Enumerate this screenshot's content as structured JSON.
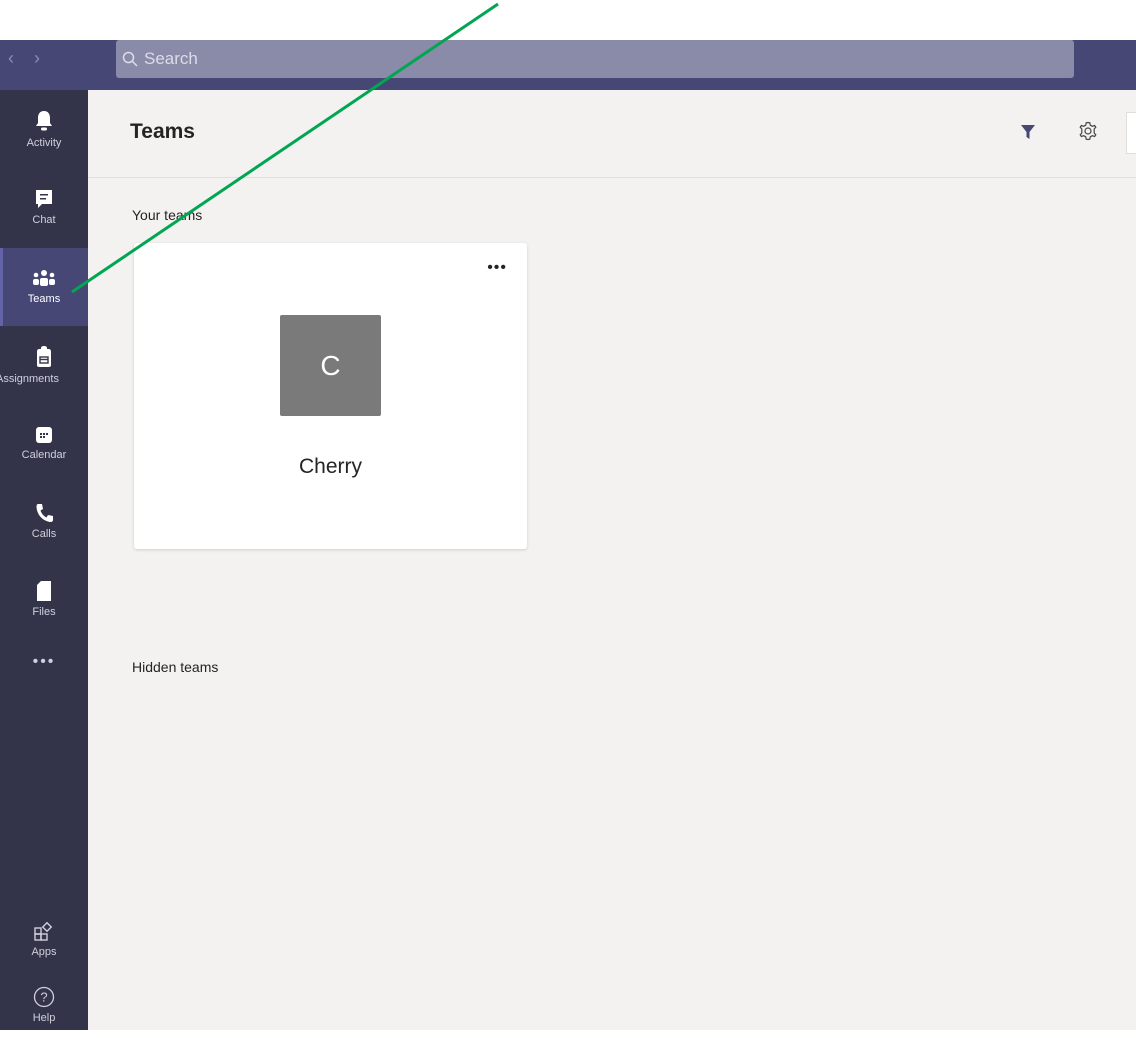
{
  "titlebar": {
    "back": "‹",
    "forward": "›",
    "search": {
      "placeholder": "Search",
      "icon": "search-icon"
    }
  },
  "rail": {
    "items": [
      {
        "label": "Activity",
        "icon": "bell-icon",
        "active": false
      },
      {
        "label": "Chat",
        "icon": "chat-icon",
        "active": false
      },
      {
        "label": "Teams",
        "icon": "teams-icon",
        "active": true
      },
      {
        "label": "Assignments",
        "icon": "backpack-icon",
        "active": false
      },
      {
        "label": "Calendar",
        "icon": "calendar-icon",
        "active": false
      },
      {
        "label": "Calls",
        "icon": "phone-icon",
        "active": false
      },
      {
        "label": "Files",
        "icon": "file-icon",
        "active": false
      }
    ],
    "more": "•••",
    "bottom": [
      {
        "label": "Apps",
        "icon": "apps-icon"
      },
      {
        "label": "Help",
        "icon": "help-icon"
      }
    ]
  },
  "main": {
    "title": "Teams",
    "your_teams_label": "Your teams",
    "hidden_teams_label": "Hidden teams",
    "teams": [
      {
        "initial": "C",
        "name": "Cherry",
        "avatar_color": "#7a7a7a",
        "more": "•••"
      }
    ]
  },
  "colors": {
    "titlebar": "#464775",
    "rail": "#33344a",
    "accent": "#6264a7",
    "annotation_arrow": "#00a651"
  }
}
